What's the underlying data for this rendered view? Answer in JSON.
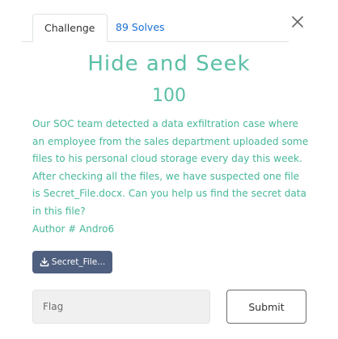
{
  "tabs": {
    "challenge_label": "Challenge",
    "solves_label": "89 Solves"
  },
  "close_icon": "close-icon",
  "challenge": {
    "name": "Hide and Seek",
    "points": "100",
    "description": "Our SOC team detected a data exfiltration case where an employee from the sales department uploaded some files to his personal cloud storage every day this week. After checking all the files, we have suspected one file is Secret_File.docx. Can you help us find the secret data in this file?",
    "author": "Author # Andro6"
  },
  "file": {
    "label": "Secret_File...",
    "icon": "download-icon"
  },
  "flag_input": {
    "placeholder": "Flag",
    "value": ""
  },
  "submit_label": "Submit",
  "colors": {
    "accent_teal": "#5bbfa6",
    "text_teal": "#47b79a",
    "link_blue": "#1a6fd1",
    "file_button": "#4f5f7f"
  }
}
